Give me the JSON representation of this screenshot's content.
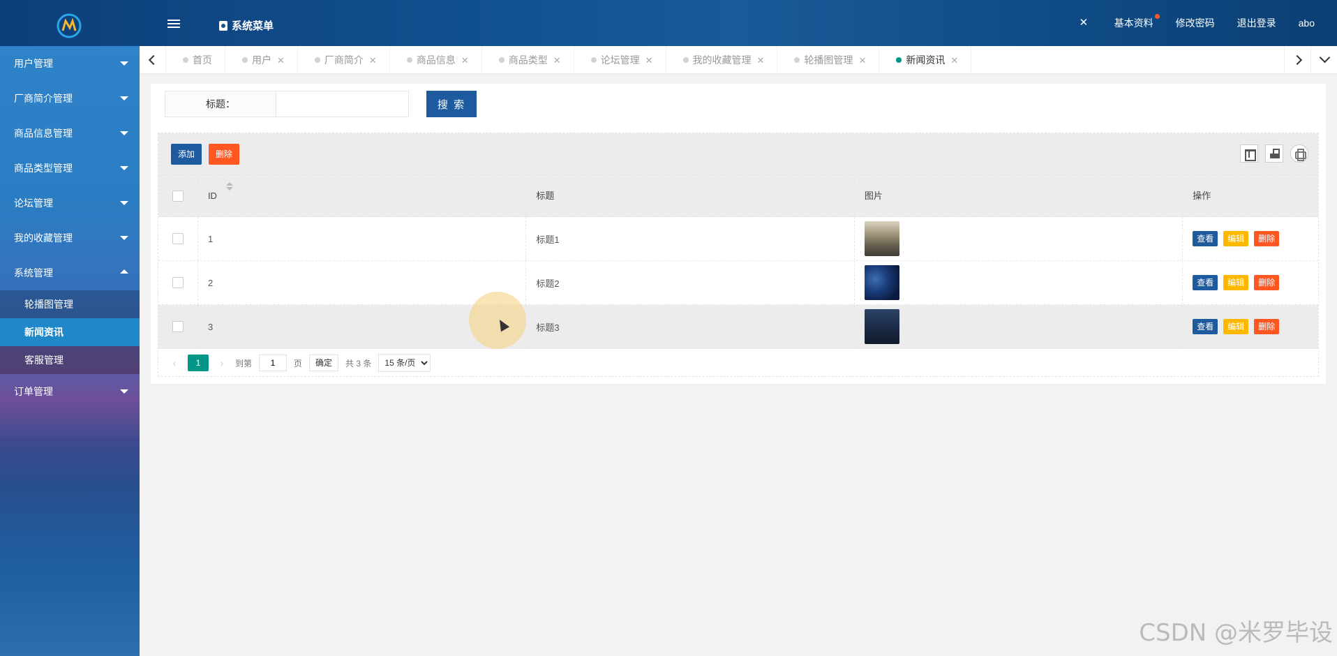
{
  "header": {
    "menu_title": "系统菜单",
    "right_items": [
      "基本资料",
      "修改密码",
      "退出登录",
      "abo"
    ]
  },
  "sidebar": {
    "items": [
      {
        "label": "用户管理"
      },
      {
        "label": "厂商简介管理"
      },
      {
        "label": "商品信息管理"
      },
      {
        "label": "商品类型管理"
      },
      {
        "label": "论坛管理"
      },
      {
        "label": "我的收藏管理"
      },
      {
        "label": "系统管理"
      },
      {
        "label": "订单管理"
      }
    ],
    "sub_items": [
      "轮播图管理",
      "新闻资讯",
      "客服管理"
    ]
  },
  "tabs": [
    {
      "label": "首页"
    },
    {
      "label": "用户"
    },
    {
      "label": "厂商简介"
    },
    {
      "label": "商品信息"
    },
    {
      "label": "商品类型"
    },
    {
      "label": "论坛管理"
    },
    {
      "label": "我的收藏管理"
    },
    {
      "label": "轮播图管理"
    },
    {
      "label": "新闻资讯"
    }
  ],
  "search": {
    "label": "标题：",
    "value": "",
    "button": "搜 索"
  },
  "toolbar": {
    "add": "添加",
    "delete": "删除"
  },
  "table": {
    "headers": [
      "ID",
      "标题",
      "图片",
      "操作"
    ],
    "rows": [
      {
        "id": "1",
        "title": "标题1"
      },
      {
        "id": "2",
        "title": "标题2"
      },
      {
        "id": "3",
        "title": "标题3"
      }
    ],
    "ops": {
      "view": "查看",
      "edit": "编辑",
      "delete": "删除"
    }
  },
  "pager": {
    "current": "1",
    "goto_label": "到第",
    "goto_value": "1",
    "page_unit": "页",
    "confirm": "确定",
    "total": "共 3 条",
    "per_page": "15 条/页"
  },
  "watermark": "CSDN @米罗毕设",
  "colors": {
    "primary": "#1e5b9e",
    "danger": "#ff5722",
    "warning": "#ffb800",
    "active": "#009688"
  }
}
